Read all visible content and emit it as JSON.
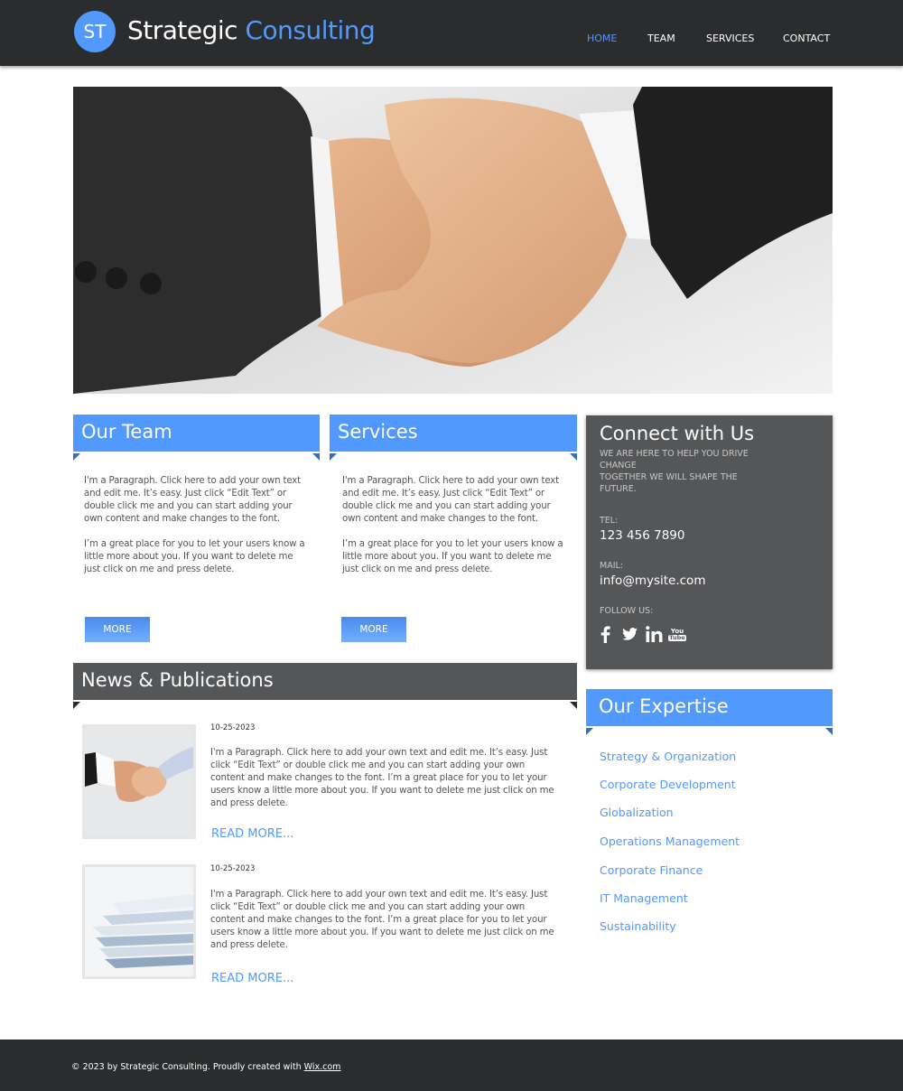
{
  "brand": {
    "monogram": "ST",
    "name_part1": "Strategic",
    "name_part2": "Consulting",
    "accent_color": "#5199fc",
    "header_bg": "#2b2c2e"
  },
  "nav": {
    "items": [
      {
        "label": "HOME",
        "active": true
      },
      {
        "label": "TEAM",
        "active": false
      },
      {
        "label": "SERVICES",
        "active": false
      },
      {
        "label": "CONTACT",
        "active": false
      }
    ]
  },
  "hero": {
    "image": "handshake-photo"
  },
  "our_team": {
    "title": "Our Team",
    "paragraph1": "I'm a Paragraph. Click here to add your own text and edit me. It’s easy. Just click “Edit Text” or double click me and you can start adding your own content and make changes to the font.",
    "paragraph2": "I’m a great place for you to let your users know a little more about you. If you want to delete me just click on me and press delete.",
    "button": "MORE"
  },
  "services": {
    "title": "Services",
    "paragraph1": "I'm a Paragraph. Click here to add your own text and edit me. It’s easy. Just click “Edit Text” or double click me and you can start adding your own content and make changes to the font.",
    "paragraph2": "I’m a great place for you to let your users know a little more about you. If you want to delete me just click on me and press delete.",
    "button": "MORE"
  },
  "connect": {
    "title": "Connect with Us",
    "tagline_line1": "WE ARE HERE TO HELP YOU DRIVE CHANGE",
    "tagline_line2": "TOGETHER WE WILL SHAPE THE FUTURE.",
    "tel_label": "TEL:",
    "tel": "123 456 7890",
    "mail_label": "MAIL:",
    "mail": "info@mysite.com",
    "follow_label": "FOLLOW US:",
    "social": [
      "facebook",
      "twitter",
      "linkedin",
      "youtube"
    ],
    "youtube_top": "You",
    "youtube_bottom": "Tube"
  },
  "news": {
    "title": "News & Publications",
    "items": [
      {
        "image": "handshake-thumbnail",
        "date": "10-25-2023",
        "text": "I'm a Paragraph. Click here to add your own text and edit me. It’s easy. Just click “Edit Text” or double click me and you can start adding your own content and make changes to the font. I’m a great place for you to let your users know a little more about you. If you want to delete me just click on me and press delete.",
        "link": "READ MORE..."
      },
      {
        "image": "documents-thumbnail",
        "date": "10-25-2023",
        "text": "I'm a Paragraph. Click here to add your own text and edit me. It’s easy. Just click “Edit Text” or double click me and you can start adding your own content and make changes to the font. I’m a great place for you to let your users know a little more about you. If you want to delete me just click on me and press delete.",
        "link": "READ MORE..."
      }
    ]
  },
  "expertise": {
    "title": "Our Expertise",
    "items": [
      "Strategy & Organization",
      "Corporate Development",
      "Globalization",
      "Operations Management",
      "Corporate Finance",
      "IT Management",
      "Sustainability"
    ]
  },
  "footer": {
    "copyright": "© 2023 by Strategic Consulting. Proudly created with ",
    "link": "Wix.com"
  }
}
